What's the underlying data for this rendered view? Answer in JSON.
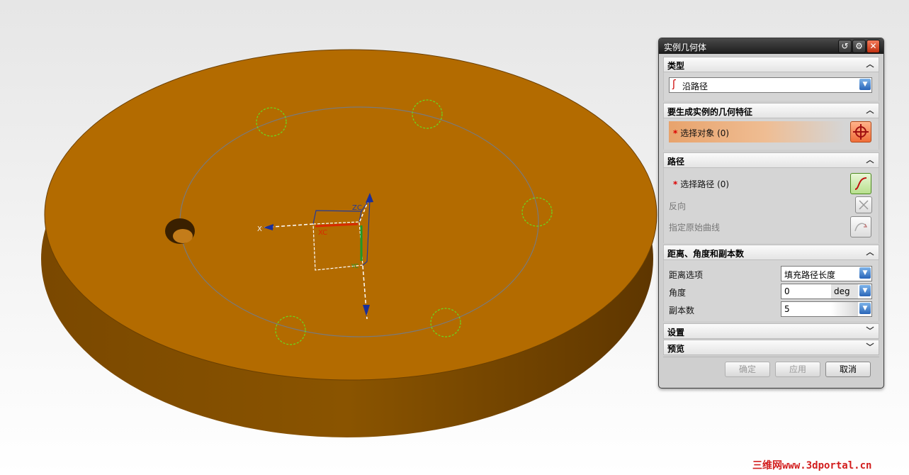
{
  "dialog": {
    "title": "实例几何体",
    "title_icons": [
      "reset-icon",
      "gear-icon",
      "close-icon"
    ],
    "sections": {
      "type": {
        "header": "类型",
        "collapse_icon": "chevron-up-icon",
        "value": "沿路径"
      },
      "geometry": {
        "header": "要生成实例的几何特征",
        "collapse_icon": "chevron-up-icon",
        "select_label": "选择对象 (0)",
        "required_mark": "*"
      },
      "path": {
        "header": "路径",
        "collapse_icon": "chevron-up-icon",
        "select_label": "选择路径 (0)",
        "required_mark": "*",
        "reverse_label": "反向",
        "origin_curve_label": "指定原始曲线"
      },
      "distance": {
        "header": "距离、角度和副本数",
        "collapse_icon": "chevron-up-icon",
        "distance_option_label": "距离选项",
        "distance_option_value": "填充路径长度",
        "angle_label": "角度",
        "angle_value": "0",
        "angle_unit": "deg",
        "copies_label": "副本数",
        "copies_value": "5"
      },
      "settings": {
        "header": "设置",
        "collapse_icon": "chevron-down-icon"
      },
      "preview": {
        "header": "预览",
        "collapse_icon": "chevron-down-icon"
      }
    },
    "buttons": {
      "ok": "确定",
      "apply": "应用",
      "cancel": "取消"
    }
  },
  "viewport": {
    "triad": {
      "x_label": "X",
      "xc_label": "XC",
      "zc_label": "ZC",
      "yc_label": "YC"
    },
    "part_color": "#b56b00",
    "accent": "#3a7fd0"
  },
  "watermark": "三维网www.3dportal.cn"
}
